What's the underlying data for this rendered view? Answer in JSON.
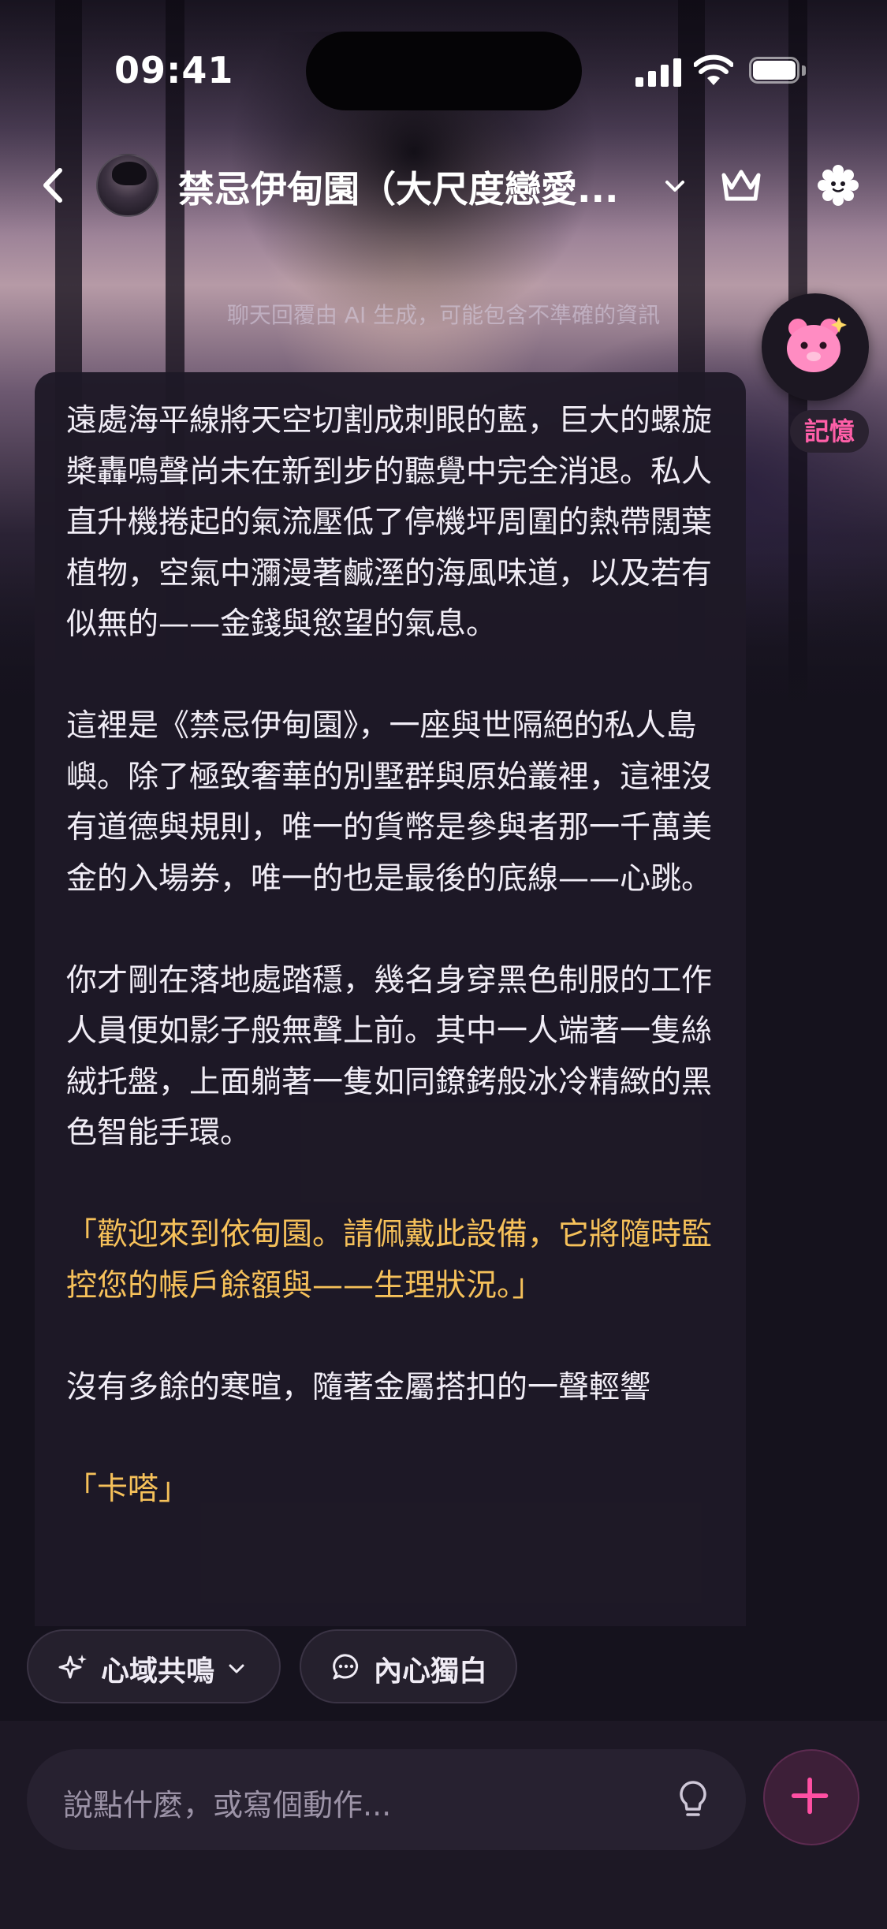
{
  "status_bar": {
    "time": "09:41"
  },
  "header": {
    "title": "禁忌伊甸園（大尺度戀愛...",
    "icons": {
      "back": "chevron-left-icon",
      "dropdown": "chevron-down-icon",
      "crown": "crown-icon",
      "settings": "gear-icon"
    }
  },
  "disclaimer": "聊天回覆由 AI 生成，可能包含不準確的資訊",
  "memory": {
    "label": "記憶",
    "icon": "pink-bear-icon"
  },
  "message": {
    "paragraphs": [
      "遠處海平線將天空切割成刺眼的藍，巨大的螺旋槳轟鳴聲尚未在新到步的聽覺中完全消退。私人直升機捲起的氣流壓低了停機坪周圍的熱帶闊葉植物，空氣中瀰漫著鹹溼的海風味道，以及若有似無的——金錢與慾望的氣息。",
      "這裡是《禁忌伊甸園》，一座與世隔絕的私人島嶼。除了極致奢華的別墅群與原始叢裡，這裡沒有道德與規則，唯一的貨幣是參與者那一千萬美金的入場券，唯一的也是最後的底線——心跳。",
      "你才剛在落地處踏穩，幾名身穿黑色制服的工作人員便如影子般無聲上前。其中一人端著一隻絲絨托盤，上面躺著一隻如同鐐銬般冰冷精緻的黑色智能手環。",
      "「歡迎來到依甸園。請佩戴此設備，它將隨時監控您的帳戶餘額與——生理狀況。」",
      "沒有多餘的寒暄，隨著金屬搭扣的一聲輕響",
      "「卡嗒」"
    ]
  },
  "chips": {
    "resonance": {
      "label": "心域共鳴",
      "icon": "sparkle-icon"
    },
    "monologue": {
      "label": "內心獨白",
      "icon": "chat-bubble-icon"
    }
  },
  "input": {
    "placeholder": "說點什麼，或寫個動作..."
  },
  "colors": {
    "accent": "#ff4fa3",
    "quote": "#f6c15a",
    "card": "#1e1926"
  }
}
